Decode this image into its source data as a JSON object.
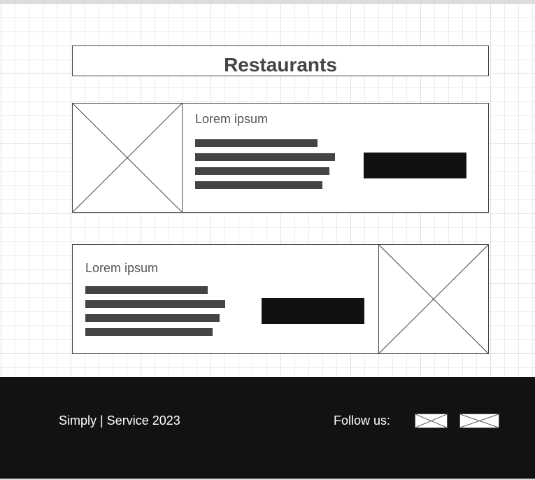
{
  "header": {
    "title": "Restaurants"
  },
  "cards": [
    {
      "title": "Lorem ipsum",
      "image": "image-placeholder",
      "button_label": ""
    },
    {
      "title": "Lorem ipsum",
      "image": "image-placeholder",
      "button_label": ""
    }
  ],
  "footer": {
    "copyright": "Simply | Service 2023",
    "follow_label": "Follow us:",
    "social_icons": [
      "social-icon-placeholder",
      "social-icon-placeholder"
    ]
  },
  "colors": {
    "dark": "#121212",
    "text_bar": "#444444",
    "button": "#111111"
  }
}
